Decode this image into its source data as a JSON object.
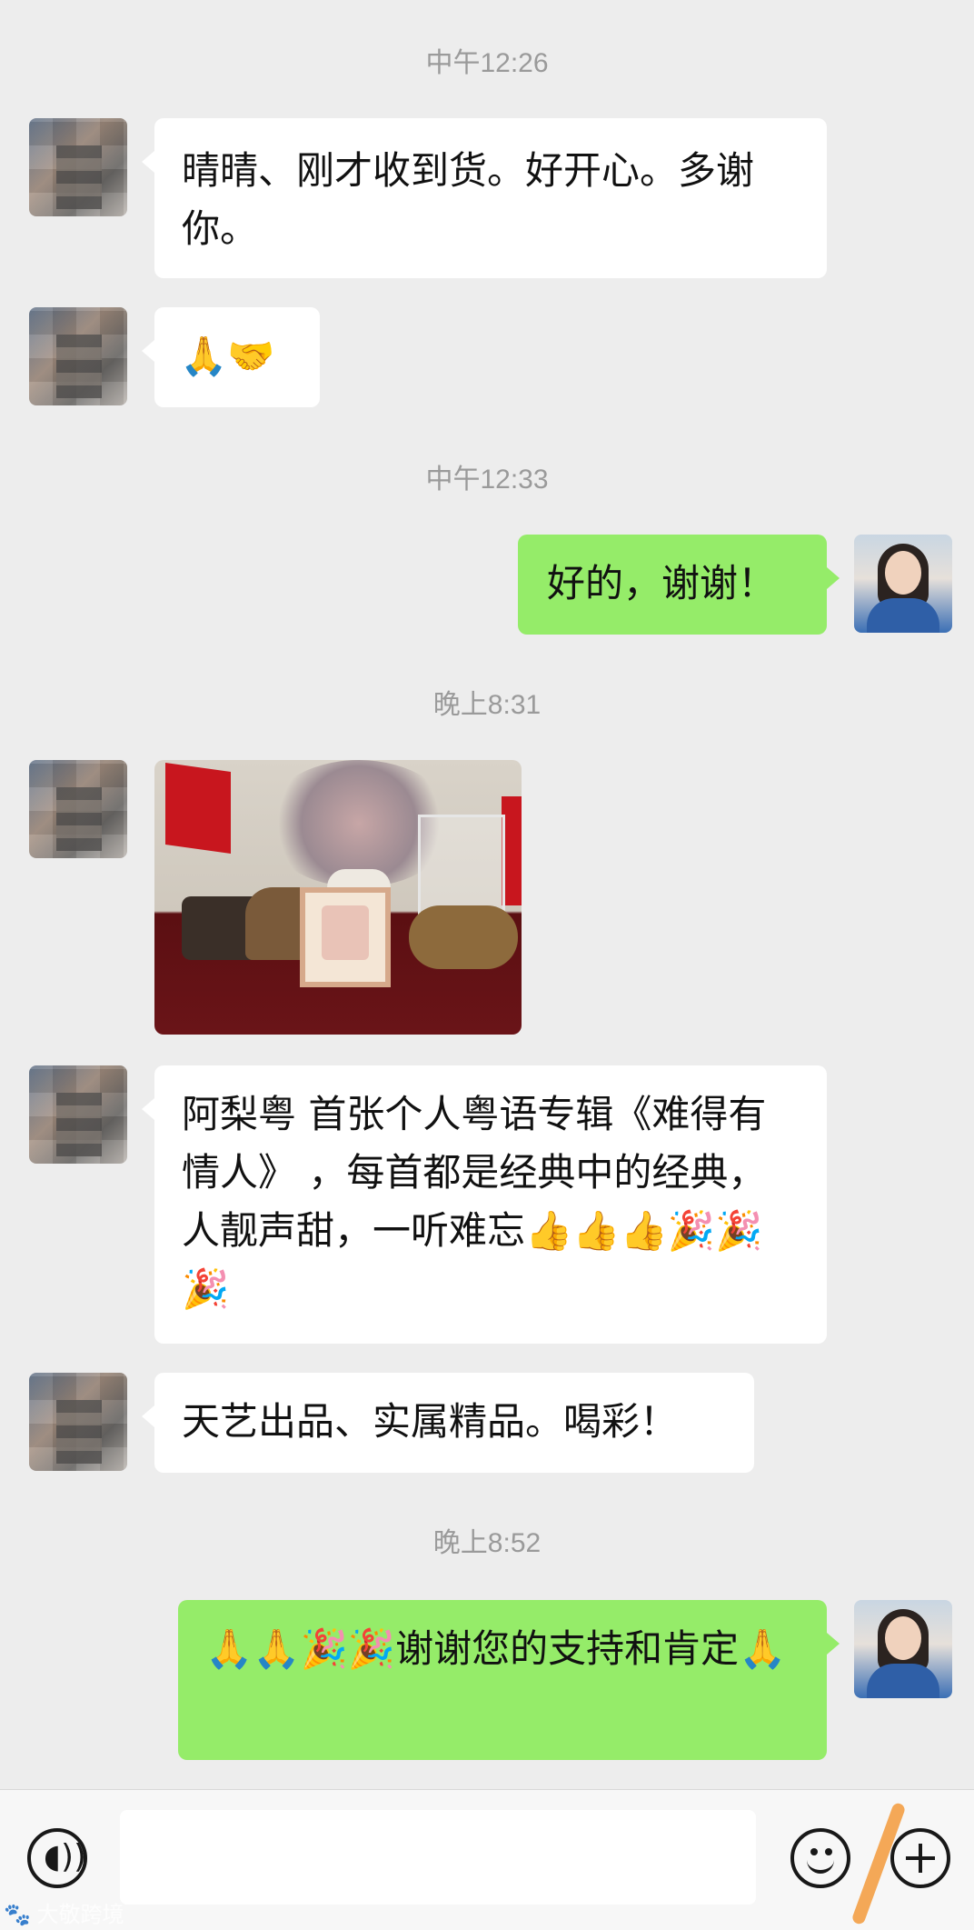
{
  "timestamps": [
    "中午12:26",
    "中午12:33",
    "晚上8:31",
    "晚上8:52"
  ],
  "messages": {
    "m1": "晴晴、刚才收到货。好开心。多谢你。",
    "m2": "🙏🤝",
    "m3": "好的，谢谢！",
    "m5": "阿梨粤 首张个人粤语专辑《难得有情人》 ，每首都是经典中的经典，人靓声甜，一听难忘👍👍👍🎉🎉🎉",
    "m6": "天艺出品、实属精品。喝彩！",
    "m7": "🙏🙏🎉🎉谢谢您的支持和肯定🙏"
  },
  "bottom_bar": {
    "voice_icon": "voice-icon",
    "voice_glyph": "◖))",
    "emoji_icon": "smile-icon",
    "plus_icon": "plus-icon"
  },
  "watermark": "🐾 大敬跨境",
  "colors": {
    "background": "#ededed",
    "sent_bubble": "#95ec69",
    "received_bubble": "#ffffff"
  }
}
